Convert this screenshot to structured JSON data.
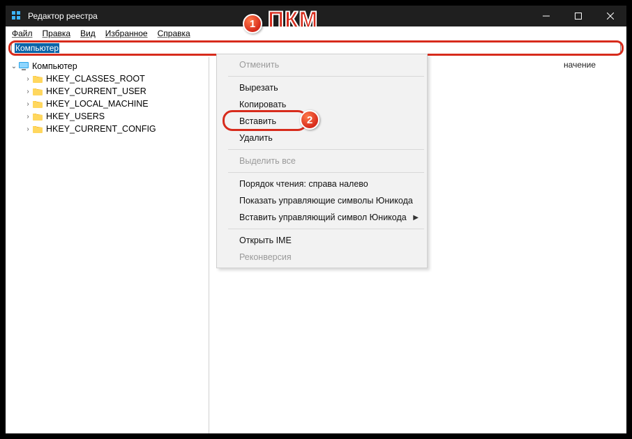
{
  "window": {
    "title": "Редактор реестра"
  },
  "menubar": {
    "file": "Файл",
    "edit": "Правка",
    "view": "Вид",
    "favorites": "Избранное",
    "help": "Справка"
  },
  "addressbar": {
    "value": "Компьютер"
  },
  "tree": {
    "root": "Компьютер",
    "items": [
      "HKEY_CLASSES_ROOT",
      "HKEY_CURRENT_USER",
      "HKEY_LOCAL_MACHINE",
      "HKEY_USERS",
      "HKEY_CURRENT_CONFIG"
    ]
  },
  "listheader": {
    "value": "начение"
  },
  "context_menu": {
    "undo": "Отменить",
    "cut": "Вырезать",
    "copy": "Копировать",
    "paste": "Вставить",
    "delete": "Удалить",
    "select_all": "Выделить все",
    "rtl": "Порядок чтения: справа налево",
    "show_unicode_ctrl": "Показать управляющие символы Юникода",
    "insert_unicode_ctrl": "Вставить управляющий символ Юникода",
    "open_ime": "Открыть IME",
    "reconversion": "Реконверсия"
  },
  "annotations": {
    "pkm": "ПКМ",
    "step1": "1",
    "step2": "2"
  }
}
